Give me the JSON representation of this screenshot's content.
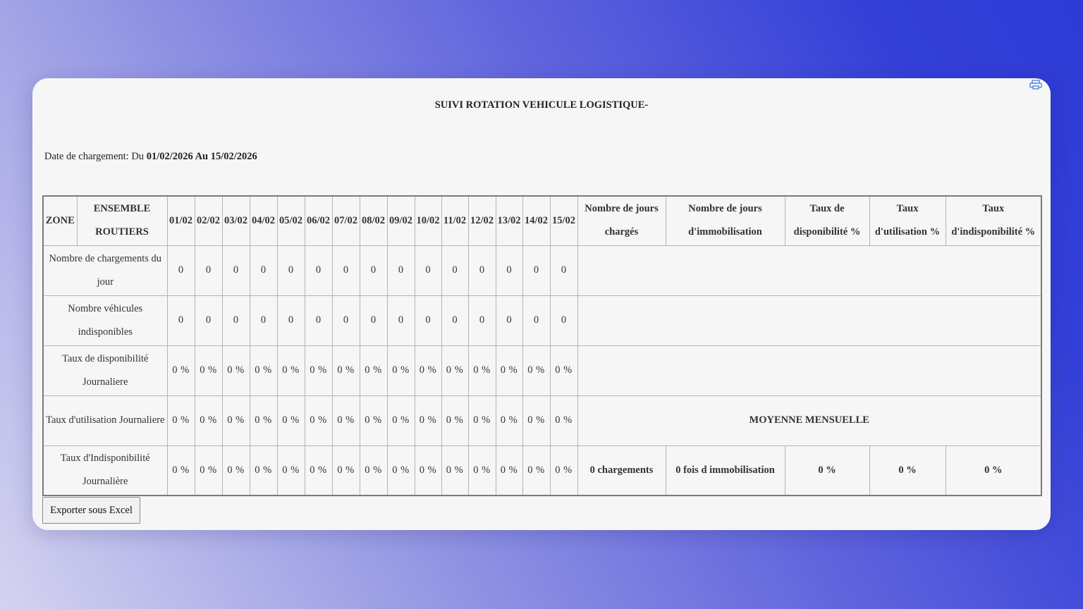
{
  "report": {
    "title": "SUIVI ROTATION VEHICULE LOGISTIQUE-",
    "date_label": "Date de chargement: Du ",
    "date_from": "01/02/2026",
    "date_sep": " Au ",
    "date_to": "15/02/2026"
  },
  "table": {
    "zone_header": "ZONE",
    "ensemble_header": "ENSEMBLE ROUTIERS",
    "dates": [
      "01/02",
      "02/02",
      "03/02",
      "04/02",
      "05/02",
      "06/02",
      "07/02",
      "08/02",
      "09/02",
      "10/02",
      "11/02",
      "12/02",
      "13/02",
      "14/02",
      "15/02"
    ],
    "summary_headers": [
      "Nombre de jours chargés",
      "Nombre de jours d'immobilisation",
      "Taux de disponibilité %",
      "Taux d'utilisation %",
      "Taux d'indisponibilité %"
    ],
    "rows": [
      {
        "label": "Nombre de chargements du jour",
        "values": [
          "0",
          "0",
          "0",
          "0",
          "0",
          "0",
          "0",
          "0",
          "0",
          "0",
          "0",
          "0",
          "0",
          "0",
          "0"
        ]
      },
      {
        "label": "Nombre véhicules indisponibles",
        "values": [
          "0",
          "0",
          "0",
          "0",
          "0",
          "0",
          "0",
          "0",
          "0",
          "0",
          "0",
          "0",
          "0",
          "0",
          "0"
        ]
      },
      {
        "label": "Taux de disponibilité Journaliere",
        "values": [
          "0 %",
          "0 %",
          "0 %",
          "0 %",
          "0 %",
          "0 %",
          "0 %",
          "0 %",
          "0 %",
          "0 %",
          "0 %",
          "0 %",
          "0 %",
          "0 %",
          "0 %"
        ]
      },
      {
        "label": "Taux d'utilisation Journaliere",
        "values": [
          "0 %",
          "0 %",
          "0 %",
          "0 %",
          "0 %",
          "0 %",
          "0 %",
          "0 %",
          "0 %",
          "0 %",
          "0 %",
          "0 %",
          "0 %",
          "0 %",
          "0 %"
        ]
      },
      {
        "label": "Taux d'Indisponibilité Journalière",
        "values": [
          "0 %",
          "0 %",
          "0 %",
          "0 %",
          "0 %",
          "0 %",
          "0 %",
          "0 %",
          "0 %",
          "0 %",
          "0 %",
          "0 %",
          "0 %",
          "0 %",
          "0 %"
        ]
      }
    ],
    "monthly_average_label": "MOYENNE MENSUELLE",
    "summary_values": [
      "0 chargements",
      "0 fois d immobilisation",
      "0 %",
      "0 %",
      "0 %"
    ]
  },
  "export_button_label": "Exporter sous Excel",
  "icons": {
    "print": "print-icon"
  }
}
